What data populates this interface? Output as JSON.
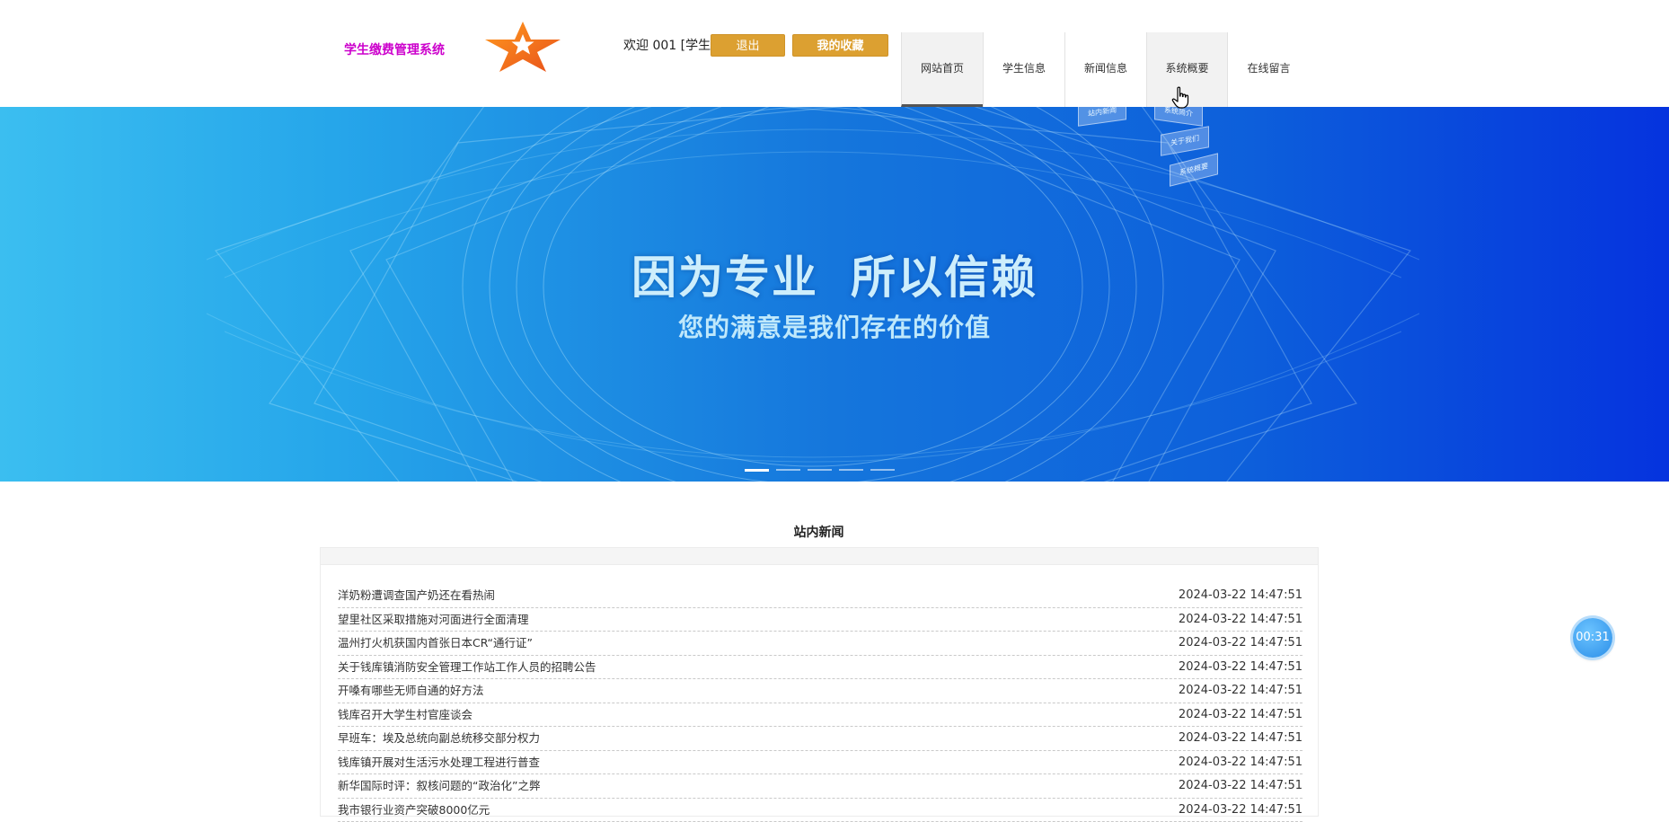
{
  "header": {
    "site_title": "学生缴费管理系统",
    "welcome": "欢迎 001 [学生]",
    "logout_label": "退出",
    "favorites_label": "我的收藏"
  },
  "nav": {
    "items": [
      {
        "label": "网站首页"
      },
      {
        "label": "学生信息"
      },
      {
        "label": "新闻信息"
      },
      {
        "label": "系统概要"
      },
      {
        "label": "在线留言"
      }
    ]
  },
  "banner": {
    "title_part1": "因为专业",
    "title_part2": "所以信赖",
    "subtitle": "您的满意是我们存在的价值",
    "card_labels": [
      "站内新闻",
      "系统简介",
      "关于我们",
      "系统概要"
    ]
  },
  "news": {
    "heading": "站内新闻",
    "items": [
      {
        "title": "洋奶粉遭调查国产奶还在看热闹",
        "date": "2024-03-22 14:47:51"
      },
      {
        "title": "望里社区采取措施对河面进行全面清理",
        "date": "2024-03-22 14:47:51"
      },
      {
        "title": "温州打火机获国内首张日本CR“通行证”",
        "date": "2024-03-22 14:47:51"
      },
      {
        "title": "关于钱库镇消防安全管理工作站工作人员的招聘公告",
        "date": "2024-03-22 14:47:51"
      },
      {
        "title": "开嗓有哪些无师自通的好方法",
        "date": "2024-03-22 14:47:51"
      },
      {
        "title": "钱库召开大学生村官座谈会",
        "date": "2024-03-22 14:47:51"
      },
      {
        "title": "早班车：埃及总统向副总统移交部分权力",
        "date": "2024-03-22 14:47:51"
      },
      {
        "title": "钱库镇开展对生活污水处理工程进行普查",
        "date": "2024-03-22 14:47:51"
      },
      {
        "title": "新华国际时评：叙核问题的“政治化”之弊",
        "date": "2024-03-22 14:47:51"
      },
      {
        "title": "我市银行业资产突破8000亿元",
        "date": "2024-03-22 14:47:51"
      }
    ]
  },
  "timer": {
    "value": "00:31"
  },
  "colors": {
    "site_title": "#cc00cc",
    "button": "#dca031",
    "banner_left": "#3bbef0",
    "banner_right": "#0533de",
    "timer": "#2b8ee8"
  },
  "icons": {
    "logo": "star-logo-icon",
    "cursor": "hand-pointer-icon"
  }
}
